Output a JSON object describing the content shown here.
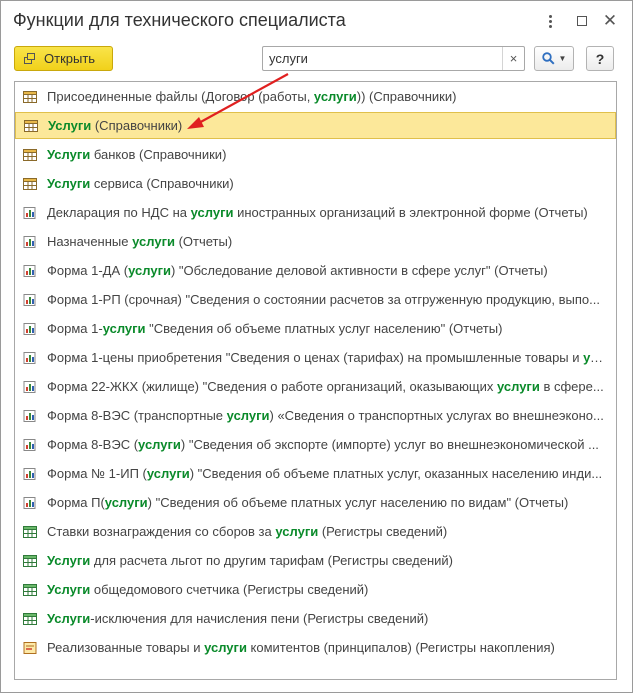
{
  "window": {
    "title": "Функции для технического специалиста"
  },
  "toolbar": {
    "open_label": "Открыть",
    "search_value": "услуги",
    "clear_symbol": "×",
    "help_symbol": "?"
  },
  "icons": {
    "catalog": "catalog-icon",
    "report": "report-icon",
    "register": "register-icon",
    "accumulation": "accumulation-register-icon"
  },
  "colors": {
    "accent_yellow": "#f5d825",
    "highlight_green": "#0a8a2a",
    "selection": "#fce89a",
    "arrow_red": "#e02020"
  },
  "rows": [
    {
      "icon": "catalog",
      "parts": [
        "Присоединенные файлы (Договор (работы, ",
        "услуги",
        ")) (Справочники)"
      ]
    },
    {
      "icon": "catalog",
      "parts": [
        "",
        "Услуги",
        " (Справочники)"
      ],
      "selected": true
    },
    {
      "icon": "catalog",
      "parts": [
        "",
        "Услуги",
        " банков (Справочники)"
      ]
    },
    {
      "icon": "catalog",
      "parts": [
        "",
        "Услуги",
        " сервиса (Справочники)"
      ]
    },
    {
      "icon": "report",
      "parts": [
        "Декларация по НДС на ",
        "услуги",
        " иностранных организаций в электронной форме (Отчеты)"
      ]
    },
    {
      "icon": "report",
      "parts": [
        "Назначенные ",
        "услуги",
        " (Отчеты)"
      ]
    },
    {
      "icon": "report",
      "parts": [
        "Форма 1-ДА (",
        "услуги",
        ") \"Обследование деловой активности в сфере услуг\" (Отчеты)"
      ]
    },
    {
      "icon": "report",
      "parts": [
        "Форма 1-РП (срочная) \"Сведения о состоянии расчетов за отгруженную продукцию, выпо...",
        "",
        ""
      ]
    },
    {
      "icon": "report",
      "parts": [
        "Форма 1-",
        "услуги",
        " \"Сведения об объеме платных услуг населению\" (Отчеты)"
      ]
    },
    {
      "icon": "report",
      "parts": [
        "Форма 1-цены приобретения \"Сведения о ценах (тарифах) на промышленные товары и ",
        "усл...",
        ""
      ]
    },
    {
      "icon": "report",
      "parts": [
        "Форма 22-ЖКХ (жилище) \"Сведения о работе организаций, оказывающих ",
        "услуги",
        " в сфере..."
      ]
    },
    {
      "icon": "report",
      "parts": [
        "Форма 8-ВЭС (транспортные ",
        "услуги",
        ") «Сведения о транспортных услугах во внешнеэконо..."
      ]
    },
    {
      "icon": "report",
      "parts": [
        "Форма 8-ВЭС (",
        "услуги",
        ") \"Сведения об экспорте (импорте) услуг во внешнеэкономической ..."
      ]
    },
    {
      "icon": "report",
      "parts": [
        "Форма № 1-ИП (",
        "услуги",
        ") \"Сведения об объеме платных услуг, оказанных населению инди..."
      ]
    },
    {
      "icon": "report",
      "parts": [
        "Форма П(",
        "услуги",
        ") \"Сведения об объеме платных услуг населению по видам\" (Отчеты)"
      ]
    },
    {
      "icon": "register",
      "parts": [
        "Ставки вознаграждения со сборов за ",
        "услуги",
        " (Регистры сведений)"
      ]
    },
    {
      "icon": "register",
      "parts": [
        "",
        "Услуги",
        " для расчета льгот по другим тарифам (Регистры сведений)"
      ]
    },
    {
      "icon": "register",
      "parts": [
        "",
        "Услуги",
        " общедомового счетчика (Регистры сведений)"
      ]
    },
    {
      "icon": "register",
      "parts": [
        "",
        "Услуги",
        "-исключения для начисления пени (Регистры сведений)"
      ]
    },
    {
      "icon": "accumulation",
      "parts": [
        "Реализованные товары и ",
        "услуги",
        " комитентов (принципалов) (Регистры накопления)"
      ]
    }
  ]
}
